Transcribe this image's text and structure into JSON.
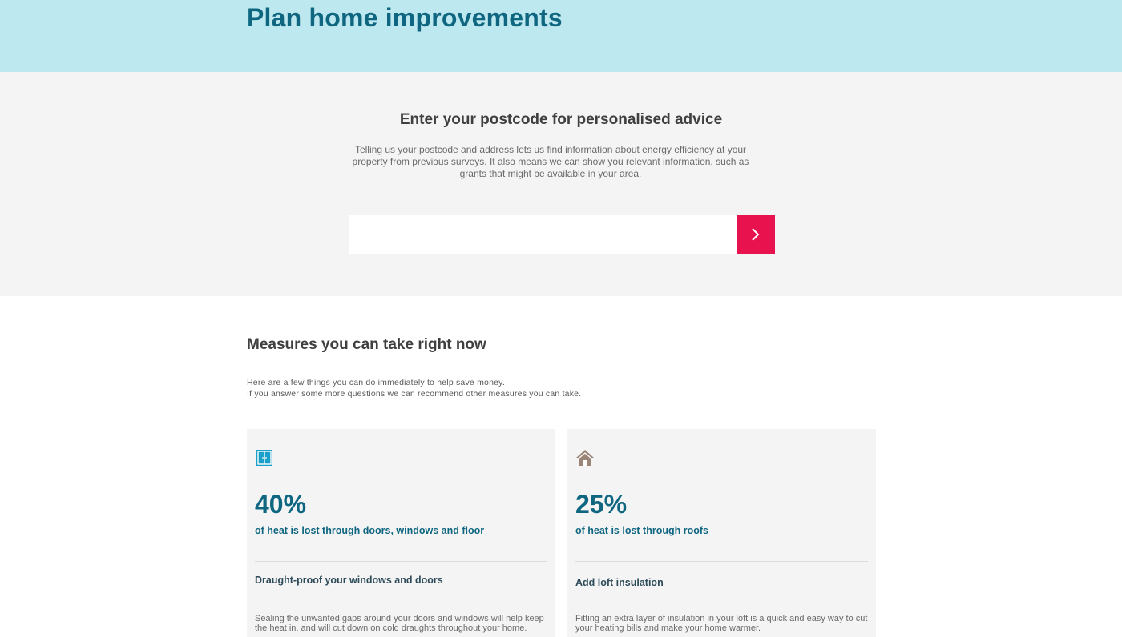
{
  "header": {
    "title": "Plan home improvements"
  },
  "postcode": {
    "heading": "Enter your postcode for personalised advice",
    "intro": "Telling us your postcode and address lets us find information about energy efficiency at your property from previous surveys. It also means we can show you relevant information, such as grants that might be available in your area.",
    "input_value": "",
    "placeholder": "",
    "submit_icon": "chevron-right-icon"
  },
  "measures": {
    "heading": "Measures you can take right now",
    "line1": "Here are a few things you can do immediately to help save money.",
    "line2": "If you answer some more questions we can recommend other measures you can take.",
    "cards": [
      {
        "icon": "window-icon",
        "stat": "40%",
        "stat_desc": "of heat is lost through doors, windows and floor",
        "title": "Draught-proof your windows and doors",
        "desc": "Sealing the unwanted gaps around your doors and windows will help keep the heat in, and will cut down on cold draughts throughout your home."
      },
      {
        "icon": "house-icon",
        "stat": "25%",
        "stat_desc": "of heat is lost through roofs",
        "title": "Add loft insulation",
        "desc": "Fitting an extra layer of insulation in your loft is a quick and easy way to cut your heating bills and make your home warmer."
      }
    ]
  },
  "colors": {
    "hero_bg": "#bee8ef",
    "brand_teal": "#0f6680",
    "accent_pink": "#e8124f",
    "panel_grey": "#f4f4f4",
    "window_icon": "#1aa0c8",
    "house_icon": "#9a8578"
  }
}
